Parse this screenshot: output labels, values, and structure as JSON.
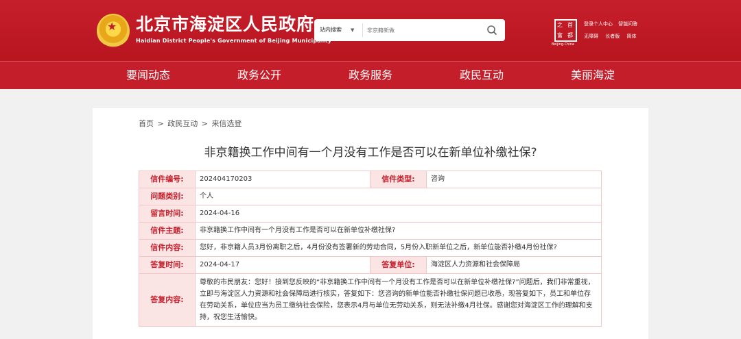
{
  "header": {
    "site_title": "北京市海淀区人民政府",
    "site_subtitle": "Haidian District People's Government of Beijing Municipality",
    "search": {
      "scope": "站内搜索",
      "placeholder": "非京籍新做",
      "value": ""
    },
    "logo": {
      "chars": [
        "之",
        "首",
        "都",
        "富"
      ],
      "caption": "Beijing·China"
    },
    "links_row1": [
      "登录个人中心",
      "智能问答"
    ],
    "links_row2": [
      "无障碍",
      "长者版",
      "简体"
    ],
    "nav": [
      "要闻动态",
      "政务公开",
      "政务服务",
      "政民互动",
      "美丽海淀"
    ]
  },
  "breadcrumb": [
    "首页",
    ">",
    "政民互动",
    ">",
    "来信选登"
  ],
  "letter": {
    "title": "非京籍换工作中间有一个月没有工作是否可以在新单位补缴社保?",
    "number_label": "信件编号:",
    "number": "202404170203",
    "type_label": "信件类型:",
    "type": "咨询",
    "category_label": "问题类别:",
    "category": "个人",
    "date_label": "留言时间:",
    "date": "2024-04-16",
    "subject_label": "信件主题:",
    "subject": "非京籍换工作中间有一个月没有工作是否可以在新单位补缴社保?",
    "content_label": "信件内容:",
    "content": "您好，非京籍人员3月份离职之后，4月份没有签署新的劳动合同，5月份入职新单位之后，新单位能否补缴4月份社保?",
    "reply_date_label": "答复时间:",
    "reply_date": "2024-04-17",
    "reply_unit_label": "答复单位:",
    "reply_unit": "海淀区人力资源和社会保障局",
    "reply_label": "答复内容:",
    "reply": "尊敬的市民朋友：您好！接到您反映的“非京籍换工作中间有一个月没有工作是否可以在新单位补缴社保?”问题后，我们非常重视，立即与海淀区人力资源和社会保障局进行核实，答复如下：您咨询的新单位能否补缴社保问题已收悉，现答复如下，员工和单位存在劳动关系，单位应当为员工缴纳社会保险，您表示4月与单位无劳动关系，则无法补缴4月社保。感谢您对海淀区工作的理解和支持，祝您生活愉快。"
  }
}
